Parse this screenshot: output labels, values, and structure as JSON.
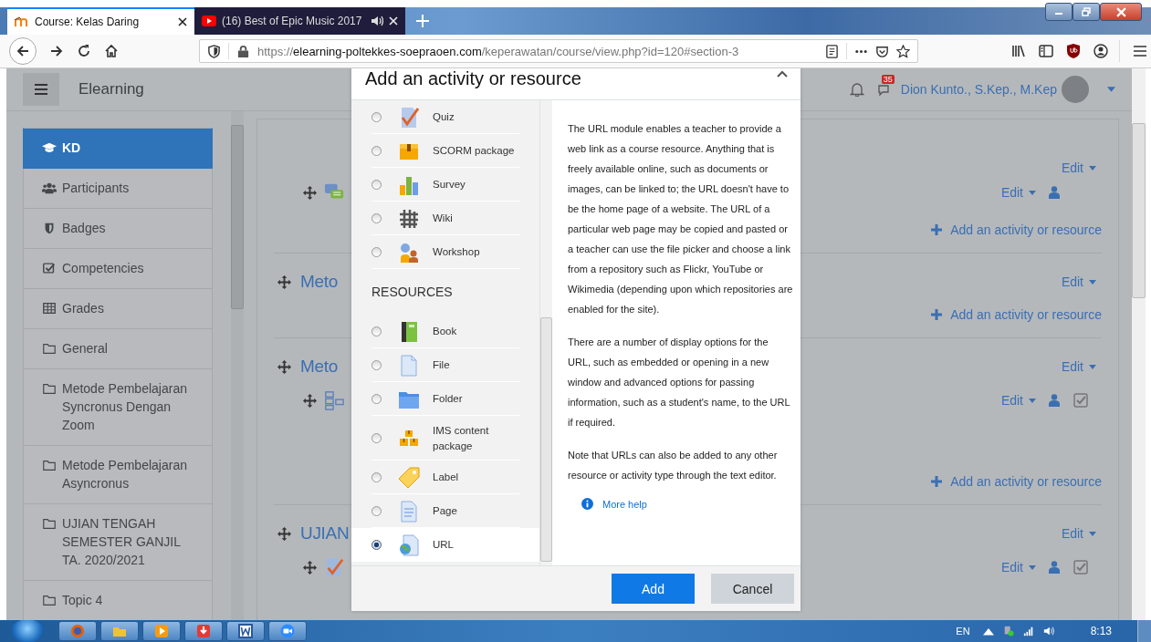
{
  "browser": {
    "tabs": [
      {
        "title": "Course: Kelas Daring",
        "audio": false,
        "selected": true
      },
      {
        "title": "(16) Best of Epic Music 2017",
        "audio": true,
        "selected": false
      }
    ],
    "url": {
      "scheme": "https://",
      "host": "elearning-poltekkes-soepraoen.com",
      "path": "/keperawatan/course/view.php?id=120#section-3"
    }
  },
  "header": {
    "site_name": "Elearning",
    "messages_badge": "35",
    "user_name": "Dion Kunto., S.Kep., M.Kep"
  },
  "sidebar": {
    "items": [
      {
        "label": "KD",
        "selected": true
      },
      {
        "label": "Participants",
        "selected": false
      },
      {
        "label": "Badges",
        "selected": false
      },
      {
        "label": "Competencies",
        "selected": false
      },
      {
        "label": "Grades",
        "selected": false
      },
      {
        "label": "General",
        "selected": false
      },
      {
        "label": "Metode Pembelajaran Syncronus Dengan Zoom",
        "selected": false
      },
      {
        "label": "Metode Pembelajaran Asyncronus",
        "selected": false
      },
      {
        "label": "UJIAN TENGAH SEMESTER GANJIL TA. 2020/2021",
        "selected": false
      },
      {
        "label": "Topic 4",
        "selected": false
      }
    ]
  },
  "sections": [
    {
      "edit": "Edit",
      "activities": [
        {
          "edit": "Edit",
          "completion": false
        }
      ],
      "add": "Add an activity or resource"
    },
    {
      "title": "Meto",
      "edit": "Edit",
      "add": "Add an activity or resource"
    },
    {
      "title": "Meto",
      "edit": "Edit",
      "activities": [
        {
          "edit": "Edit",
          "completion": true
        }
      ],
      "add": "Add an activity or resource"
    },
    {
      "title": "UJIAN",
      "edit": "Edit",
      "activities": [
        {
          "edit": "Edit",
          "completion": true
        }
      ]
    }
  ],
  "modal": {
    "title": "Add an activity or resource",
    "items": [
      {
        "kind": "option",
        "label": "Quiz",
        "selected": false
      },
      {
        "kind": "option",
        "label": "SCORM package",
        "selected": false
      },
      {
        "kind": "option",
        "label": "Survey",
        "selected": false
      },
      {
        "kind": "option",
        "label": "Wiki",
        "selected": false
      },
      {
        "kind": "option",
        "label": "Workshop",
        "selected": false
      },
      {
        "kind": "heading",
        "label": "RESOURCES"
      },
      {
        "kind": "option",
        "label": "Book",
        "selected": false
      },
      {
        "kind": "option",
        "label": "File",
        "selected": false
      },
      {
        "kind": "option",
        "label": "Folder",
        "selected": false
      },
      {
        "kind": "option",
        "label": "IMS content package",
        "selected": false
      },
      {
        "kind": "option",
        "label": "Label",
        "selected": false
      },
      {
        "kind": "option",
        "label": "Page",
        "selected": false
      },
      {
        "kind": "option",
        "label": "URL",
        "selected": true
      }
    ],
    "description": [
      "The URL module enables a teacher to provide a web link as a course resource. Anything that is freely available online, such as documents or images, can be linked to; the URL doesn't have to be the home page of a website. The URL of a particular web page may be copied and pasted or a teacher can use the file picker and choose a link from a repository such as Flickr, YouTube or Wikimedia (depending upon which repositories are enabled for the site).",
      "There are a number of display options for the URL, such as embedded or opening in a new window and advanced options for passing information, such as a student's name, to the URL if required.",
      "Note that URLs can also be added to any other resource or activity type through the text editor."
    ],
    "help_link": "More help",
    "buttons": {
      "add": "Add",
      "cancel": "Cancel"
    }
  },
  "taskbar": {
    "language": "EN",
    "clock": "8:13"
  }
}
